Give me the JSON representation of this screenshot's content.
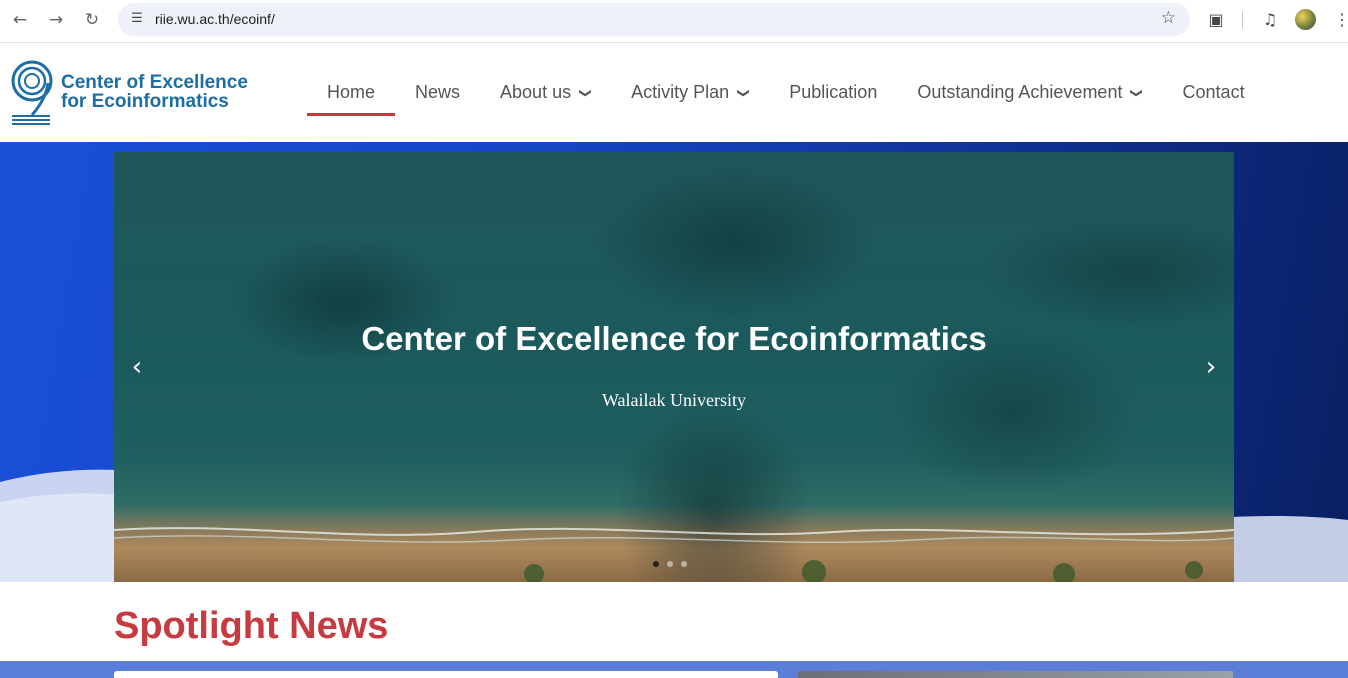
{
  "browser": {
    "url": "riie.wu.ac.th/ecoinf/",
    "icons": {
      "back": "arrow-left-icon",
      "forward": "arrow-right-icon",
      "reload": "reload-icon",
      "site_info": "tune-icon",
      "bookmark": "star-icon",
      "extensions": "puzzle-icon",
      "media": "playlist-icon",
      "profile": "avatar",
      "menu": "kebab-icon"
    }
  },
  "site": {
    "logo_line1": "Center of Excellence",
    "logo_line2": "for Ecoinformatics",
    "brand_color": "#1c6ea4",
    "accent_color": "#c73a3f"
  },
  "menu": {
    "items": [
      {
        "label": "Home",
        "active": true,
        "dropdown": false
      },
      {
        "label": "News",
        "active": false,
        "dropdown": false
      },
      {
        "label": "About us",
        "active": false,
        "dropdown": true
      },
      {
        "label": "Activity Plan",
        "active": false,
        "dropdown": true
      },
      {
        "label": "Publication",
        "active": false,
        "dropdown": false
      },
      {
        "label": "Outstanding Achievement",
        "active": false,
        "dropdown": true
      },
      {
        "label": "Contact",
        "active": false,
        "dropdown": false
      }
    ]
  },
  "hero": {
    "title": "Center of Excellence for Ecoinformatics",
    "subtitle": "Walailak University",
    "slide_count": 3,
    "active_slide": 1
  },
  "spotlight": {
    "heading": "Spotlight News"
  }
}
